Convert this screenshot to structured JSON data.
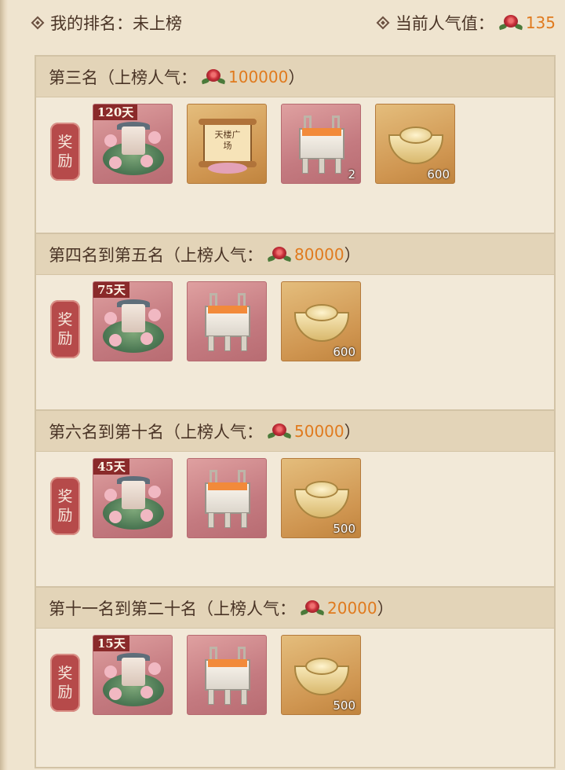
{
  "header": {
    "my_rank_label": "我的排名：",
    "my_rank_value": "未上榜",
    "popularity_label": "当前人气值：",
    "popularity_value": "135"
  },
  "reward_label": [
    "奖",
    "励"
  ],
  "tiers": [
    {
      "title": "第三名（上榜人气：",
      "threshold": "100000",
      "close": "）",
      "items": [
        {
          "icon": "garden-scene-icon",
          "style": "red",
          "badge": "120天",
          "qty": ""
        },
        {
          "icon": "scroll-icon",
          "style": "gold",
          "badge": "",
          "qty": "",
          "scroll_text": "天楼广场"
        },
        {
          "icon": "bronze-ding-icon",
          "style": "red",
          "badge": "",
          "qty": "2"
        },
        {
          "icon": "gold-ingot-icon",
          "style": "gold",
          "badge": "",
          "qty": "600"
        }
      ]
    },
    {
      "title": "第四名到第五名（上榜人气：",
      "threshold": "80000",
      "close": "）",
      "items": [
        {
          "icon": "garden-scene-icon",
          "style": "red",
          "badge": "75天",
          "qty": ""
        },
        {
          "icon": "bronze-ding-icon",
          "style": "red",
          "badge": "",
          "qty": ""
        },
        {
          "icon": "gold-ingot-icon",
          "style": "gold",
          "badge": "",
          "qty": "600"
        }
      ]
    },
    {
      "title": "第六名到第十名（上榜人气：",
      "threshold": "50000",
      "close": "）",
      "items": [
        {
          "icon": "garden-scene-icon",
          "style": "red",
          "badge": "45天",
          "qty": ""
        },
        {
          "icon": "bronze-ding-icon",
          "style": "red",
          "badge": "",
          "qty": ""
        },
        {
          "icon": "gold-ingot-icon",
          "style": "gold",
          "badge": "",
          "qty": "500"
        }
      ]
    },
    {
      "title": "第十一名到第二十名（上榜人气：",
      "threshold": "20000",
      "close": "）",
      "items": [
        {
          "icon": "garden-scene-icon",
          "style": "red",
          "badge": "15天",
          "qty": ""
        },
        {
          "icon": "bronze-ding-icon",
          "style": "red",
          "badge": "",
          "qty": ""
        },
        {
          "icon": "gold-ingot-icon",
          "style": "gold",
          "badge": "",
          "qty": "500"
        }
      ]
    }
  ],
  "colors": {
    "background": "#efe4cf",
    "section_header": "#e3d4b8",
    "accent_value": "#e07a1e",
    "award_tag": "#b64a4a"
  }
}
